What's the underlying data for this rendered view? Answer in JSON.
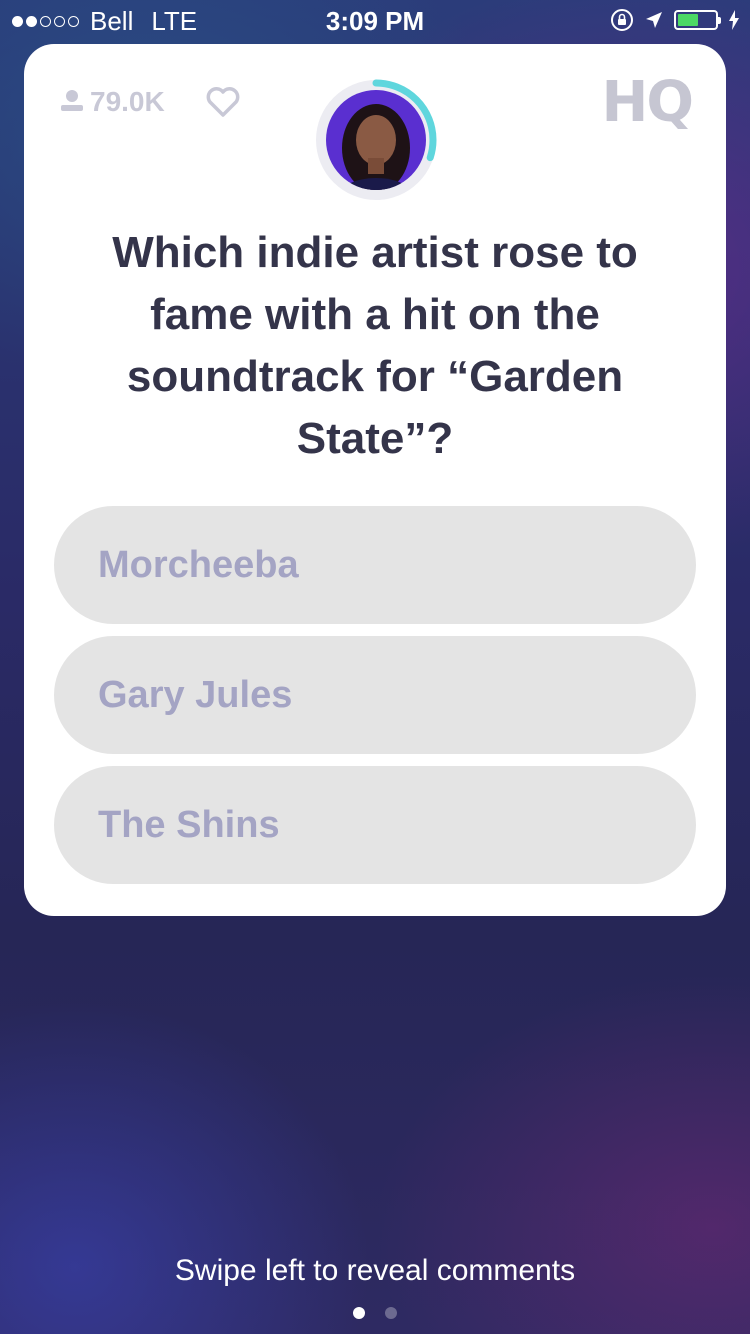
{
  "status_bar": {
    "signal_dots": {
      "filled": 2,
      "total": 5
    },
    "carrier": "Bell",
    "network": "LTE",
    "time": "3:09 PM",
    "battery_level": 0.55,
    "icons": [
      "orientation-lock-icon",
      "location-arrow-icon",
      "battery-icon",
      "charging-bolt-icon"
    ]
  },
  "card": {
    "viewer_count": "79.0K",
    "logo": "HQ",
    "timer_progress": 0.3,
    "question": "Which indie artist rose to fame with a hit on the soundtrack for “Garden State”?",
    "answers": [
      {
        "label": "Morcheeba"
      },
      {
        "label": "Gary Jules"
      },
      {
        "label": "The Shins"
      }
    ]
  },
  "footer": {
    "hint": "Swipe left to reveal comments",
    "page_count": 2,
    "active_page": 0
  },
  "colors": {
    "battery": "#4cd964",
    "timer_ring": "#5fd6dd",
    "answer_bg": "#e4e4e4",
    "answer_text": "#a4a4c4",
    "question_text": "#34344a"
  }
}
